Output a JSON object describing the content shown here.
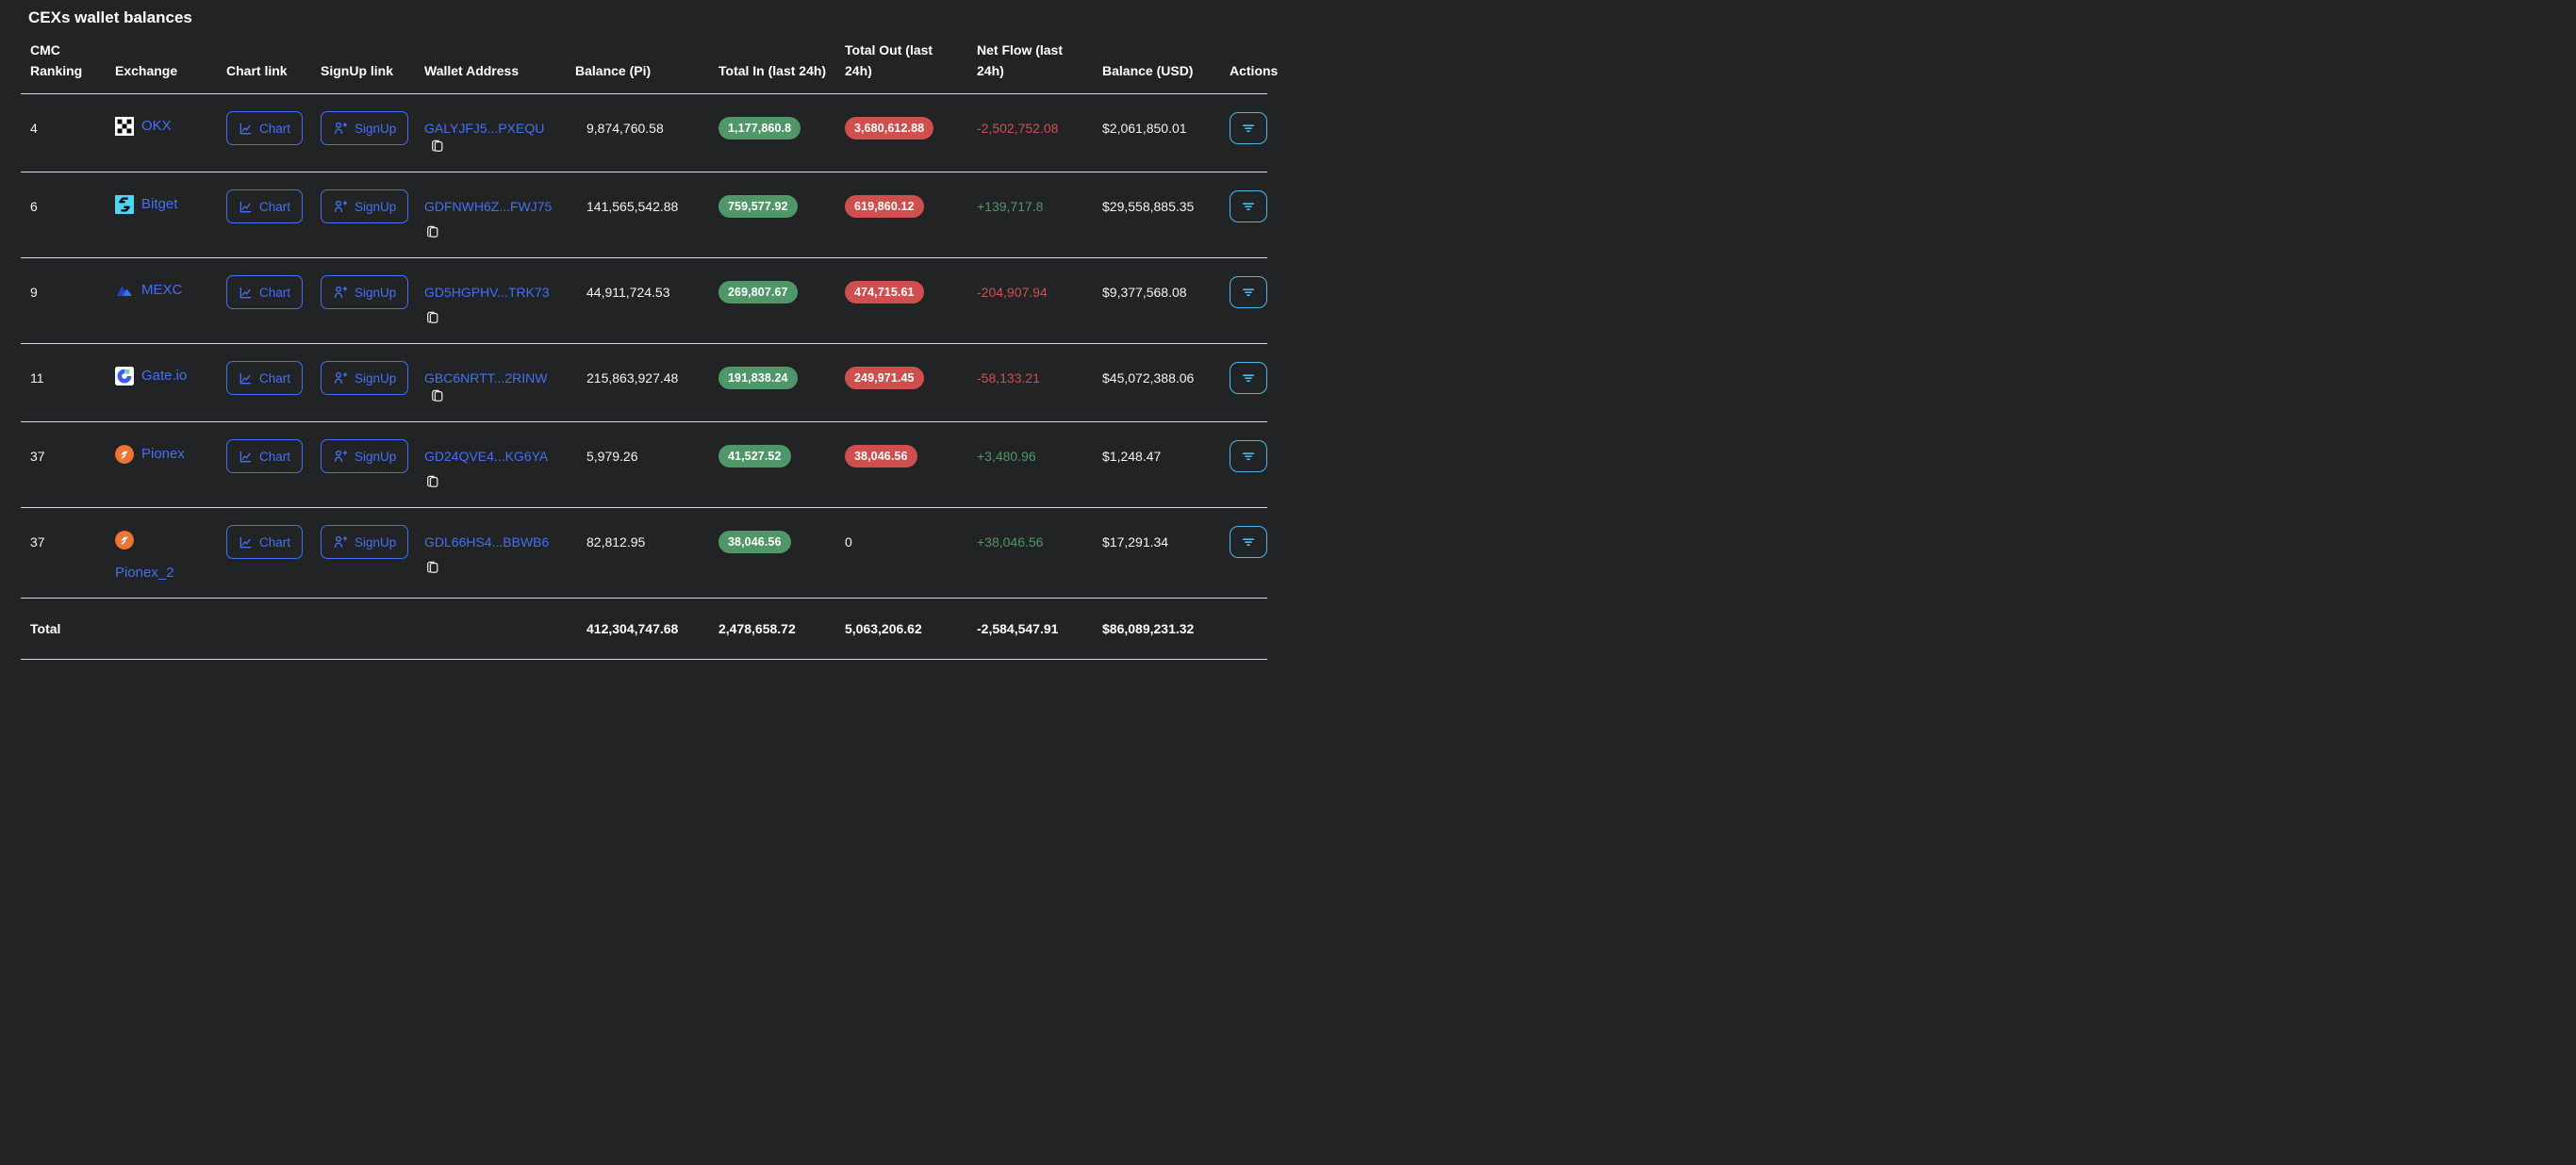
{
  "title": "CEXs wallet balances",
  "colors": {
    "bg": "#222324",
    "divider": "#d8dade",
    "link": "#4370f4",
    "green": "#4f9768",
    "red": "#cf4e4e",
    "green-text": "#4f9768",
    "red-text": "#cd5052",
    "skyblue": "#4db6ea"
  },
  "table": {
    "columns": [
      "CMC Ranking",
      "Exchange",
      "Chart link",
      "SignUp link",
      "Wallet Address",
      "Balance (Pi)",
      "Total In (last 24h)",
      "Total Out (last 24h)",
      "Net Flow (last 24h)",
      "Balance (USD)",
      "Actions"
    ],
    "chart_button_label": "Chart",
    "signup_button_label": "SignUp",
    "icons": {
      "chart": "line-chart-icon",
      "signup": "person-plus-icon",
      "copy": "copy-icon",
      "actions": "filter-icon"
    },
    "rows": [
      {
        "ranking": "4",
        "exchange": "OKX",
        "logo": "okx-logo-icon",
        "wallet": "GALYJFJ5...PXEQU",
        "balance_pi": "9,874,760.58",
        "total_in": "1,177,860.8",
        "total_out": "3,680,612.88",
        "net_flow": "-2,502,752.08",
        "balance_usd": "$2,061,850.01"
      },
      {
        "ranking": "6",
        "exchange": "Bitget",
        "logo": "bitget-logo-icon",
        "wallet": "GDFNWH6Z...FWJ75",
        "balance_pi": "141,565,542.88",
        "total_in": "759,577.92",
        "total_out": "619,860.12",
        "net_flow": "+139,717.8",
        "balance_usd": "$29,558,885.35"
      },
      {
        "ranking": "9",
        "exchange": "MEXC",
        "logo": "mexc-logo-icon",
        "wallet": "GD5HGPHV...TRK73",
        "balance_pi": "44,911,724.53",
        "total_in": "269,807.67",
        "total_out": "474,715.61",
        "net_flow": "-204,907.94",
        "balance_usd": "$9,377,568.08"
      },
      {
        "ranking": "11",
        "exchange": "Gate.io",
        "logo": "gateio-logo-icon",
        "wallet": "GBC6NRTT...2RINW",
        "balance_pi": "215,863,927.48",
        "total_in": "191,838.24",
        "total_out": "249,971.45",
        "net_flow": "-58,133.21",
        "balance_usd": "$45,072,388.06"
      },
      {
        "ranking": "37",
        "exchange": "Pionex",
        "logo": "pionex-logo-icon",
        "wallet": "GD24QVE4...KG6YA",
        "balance_pi": "5,979.26",
        "total_in": "41,527.52",
        "total_out": "38,046.56",
        "net_flow": "+3,480.96",
        "balance_usd": "$1,248.47"
      },
      {
        "ranking": "37",
        "exchange": "Pionex_2",
        "logo": "pionex-logo-icon",
        "wallet": "GDL66HS4...BBWB6",
        "balance_pi": "82,812.95",
        "total_in": "38,046.56",
        "total_out": "0",
        "net_flow": "+38,046.56",
        "balance_usd": "$17,291.34"
      }
    ],
    "total": {
      "label": "Total",
      "balance_pi": "412,304,747.68",
      "total_in": "2,478,658.72",
      "total_out": "5,063,206.62",
      "net_flow": "-2,584,547.91",
      "balance_usd": "$86,089,231.32"
    }
  }
}
